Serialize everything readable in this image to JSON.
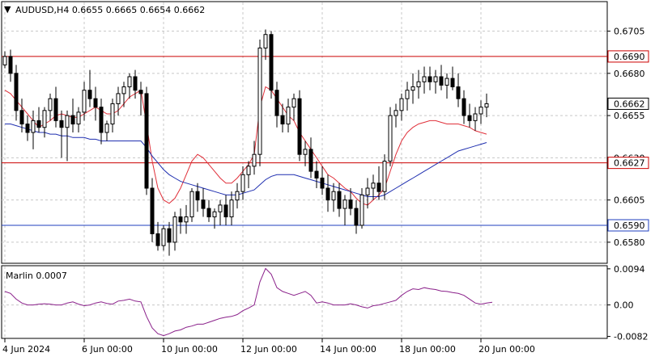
{
  "header": {
    "menu_glyph": "▼",
    "symbol_line": "AUDUSD,H4  0.6655 0.6665 0.6654 0.6662"
  },
  "chart_data": [
    {
      "type": "candlestick",
      "symbol": "AUDUSD",
      "timeframe": "H4",
      "ohlc_last": {
        "open": 0.6655,
        "high": 0.6665,
        "low": 0.6654,
        "close": 0.6662
      },
      "ylim": [
        0.6568,
        0.6722
      ],
      "y_ticks": [
        0.6705,
        0.668,
        0.6655,
        0.663,
        0.6605,
        0.658
      ],
      "y_tick_labels": [
        "0.6705",
        "0.6680",
        "0.6655",
        "0.6630",
        "0.6605",
        "0.6580"
      ],
      "x_tick_labels": [
        "4 Jun 2024",
        "6 Jun 00:00",
        "10 Jun 00:00",
        "12 Jun 00:00",
        "14 Jun 00:00",
        "18 Jun 00:00",
        "20 Jun 00:00"
      ],
      "x_tick_bar_index": [
        0,
        14,
        28,
        42,
        56,
        70,
        84
      ],
      "bar_count": 92,
      "grid": true,
      "horizontal_levels": [
        {
          "value": 0.669,
          "label": "0.6690",
          "color": "#cc0000"
        },
        {
          "value": 0.6627,
          "label": "0.6627",
          "color": "#cc0000"
        },
        {
          "value": 0.659,
          "label": "0.6590",
          "color": "#1f3fbf"
        }
      ],
      "current_price": {
        "value": 0.6662,
        "label": "0.6662"
      },
      "candles": [
        [
          0.6685,
          0.6693,
          0.6683,
          0.669
        ],
        [
          0.669,
          0.6694,
          0.6675,
          0.668
        ],
        [
          0.668,
          0.6685,
          0.6652,
          0.6658
        ],
        [
          0.6658,
          0.6665,
          0.6645,
          0.665
        ],
        [
          0.665,
          0.6655,
          0.664,
          0.6645
        ],
        [
          0.6645,
          0.6658,
          0.6635,
          0.6652
        ],
        [
          0.6652,
          0.666,
          0.6645,
          0.6648
        ],
        [
          0.6648,
          0.666,
          0.6642,
          0.6658
        ],
        [
          0.6658,
          0.6668,
          0.6652,
          0.6665
        ],
        [
          0.6665,
          0.6672,
          0.6648,
          0.6652
        ],
        [
          0.6652,
          0.6658,
          0.663,
          0.6648
        ],
        [
          0.6648,
          0.6658,
          0.6628,
          0.6655
        ],
        [
          0.6655,
          0.6665,
          0.6645,
          0.665
        ],
        [
          0.665,
          0.666,
          0.6645,
          0.6657
        ],
        [
          0.6657,
          0.6675,
          0.6652,
          0.667
        ],
        [
          0.667,
          0.6682,
          0.666,
          0.6665
        ],
        [
          0.6665,
          0.6672,
          0.6652,
          0.666
        ],
        [
          0.666,
          0.6665,
          0.6638,
          0.6645
        ],
        [
          0.6645,
          0.6652,
          0.664,
          0.665
        ],
        [
          0.665,
          0.6665,
          0.6645,
          0.6662
        ],
        [
          0.6662,
          0.6672,
          0.6655,
          0.6668
        ],
        [
          0.6668,
          0.6675,
          0.666,
          0.6672
        ],
        [
          0.6672,
          0.668,
          0.6665,
          0.6678
        ],
        [
          0.6678,
          0.6682,
          0.6665,
          0.667
        ],
        [
          0.667,
          0.6675,
          0.6655,
          0.6668
        ],
        [
          0.6668,
          0.6672,
          0.6608,
          0.6612
        ],
        [
          0.6612,
          0.6618,
          0.658,
          0.6585
        ],
        [
          0.6585,
          0.6592,
          0.6575,
          0.6578
        ],
        [
          0.6578,
          0.659,
          0.6575,
          0.6588
        ],
        [
          0.6588,
          0.6592,
          0.6572,
          0.658
        ],
        [
          0.658,
          0.6598,
          0.6575,
          0.6595
        ],
        [
          0.6595,
          0.66,
          0.6585,
          0.6592
        ],
        [
          0.6592,
          0.6602,
          0.6585,
          0.6595
        ],
        [
          0.6595,
          0.6612,
          0.6592,
          0.661
        ],
        [
          0.661,
          0.6615,
          0.6598,
          0.6605
        ],
        [
          0.6605,
          0.6612,
          0.6595,
          0.66
        ],
        [
          0.66,
          0.6605,
          0.6592,
          0.6595
        ],
        [
          0.6595,
          0.66,
          0.6588,
          0.6598
        ],
        [
          0.6598,
          0.6605,
          0.659,
          0.6602
        ],
        [
          0.6602,
          0.6608,
          0.659,
          0.6595
        ],
        [
          0.6595,
          0.661,
          0.659,
          0.6605
        ],
        [
          0.6605,
          0.6615,
          0.66,
          0.661
        ],
        [
          0.661,
          0.6625,
          0.6605,
          0.662
        ],
        [
          0.662,
          0.6628,
          0.6612,
          0.6625
        ],
        [
          0.6625,
          0.664,
          0.662,
          0.6632
        ],
        [
          0.6632,
          0.67,
          0.6625,
          0.6695
        ],
        [
          0.6695,
          0.6706,
          0.6688,
          0.6703
        ],
        [
          0.6703,
          0.6705,
          0.6665,
          0.667
        ],
        [
          0.667,
          0.6675,
          0.6648,
          0.6655
        ],
        [
          0.6655,
          0.6662,
          0.6645,
          0.665
        ],
        [
          0.665,
          0.6665,
          0.6645,
          0.666
        ],
        [
          0.666,
          0.6668,
          0.6652,
          0.6665
        ],
        [
          0.6665,
          0.667,
          0.6628,
          0.6632
        ],
        [
          0.6632,
          0.664,
          0.6625,
          0.6635
        ],
        [
          0.6635,
          0.6642,
          0.6618,
          0.6622
        ],
        [
          0.6622,
          0.6628,
          0.6612,
          0.6618
        ],
        [
          0.6618,
          0.6625,
          0.6608,
          0.6612
        ],
        [
          0.6612,
          0.662,
          0.6598,
          0.6605
        ],
        [
          0.6605,
          0.6615,
          0.6598,
          0.661
        ],
        [
          0.661,
          0.6615,
          0.6595,
          0.66
        ],
        [
          0.66,
          0.6608,
          0.659,
          0.6605
        ],
        [
          0.6605,
          0.6612,
          0.6596,
          0.66
        ],
        [
          0.66,
          0.6605,
          0.6585,
          0.659
        ],
        [
          0.659,
          0.6612,
          0.6588,
          0.6608
        ],
        [
          0.6608,
          0.6618,
          0.66,
          0.6612
        ],
        [
          0.6612,
          0.662,
          0.6605,
          0.6615
        ],
        [
          0.6615,
          0.6625,
          0.6605,
          0.661
        ],
        [
          0.661,
          0.6632,
          0.6605,
          0.6628
        ],
        [
          0.6628,
          0.666,
          0.6625,
          0.6655
        ],
        [
          0.6655,
          0.6662,
          0.6648,
          0.6658
        ],
        [
          0.6658,
          0.6668,
          0.6652,
          0.6665
        ],
        [
          0.6665,
          0.6675,
          0.6658,
          0.667
        ],
        [
          0.667,
          0.668,
          0.6662,
          0.6672
        ],
        [
          0.6672,
          0.6682,
          0.6665,
          0.6675
        ],
        [
          0.6675,
          0.6684,
          0.6668,
          0.6678
        ],
        [
          0.6678,
          0.6684,
          0.667,
          0.6675
        ],
        [
          0.6675,
          0.6682,
          0.6668,
          0.6678
        ],
        [
          0.6678,
          0.6685,
          0.667,
          0.6673
        ],
        [
          0.6673,
          0.668,
          0.6665,
          0.6677
        ],
        [
          0.6677,
          0.6684,
          0.667,
          0.6672
        ],
        [
          0.6672,
          0.668,
          0.666,
          0.6665
        ],
        [
          0.6665,
          0.667,
          0.665,
          0.6655
        ],
        [
          0.6655,
          0.6662,
          0.6648,
          0.6652
        ],
        [
          0.6652,
          0.666,
          0.6646,
          0.6656
        ],
        [
          0.6656,
          0.6664,
          0.665,
          0.666
        ],
        [
          0.666,
          0.6668,
          0.6654,
          0.6662
        ]
      ],
      "indicators": [
        {
          "color": "#e0303a",
          "values": [
            0.667,
            0.6668,
            0.6664,
            0.666,
            0.6656,
            0.6652,
            0.6648,
            0.665,
            0.6652,
            0.6655,
            0.6656,
            0.6655,
            0.6654,
            0.6654,
            0.6656,
            0.6658,
            0.666,
            0.6658,
            0.6656,
            0.6656,
            0.6658,
            0.6662,
            0.6666,
            0.6668,
            0.667,
            0.665,
            0.6628,
            0.6612,
            0.6605,
            0.6603,
            0.6606,
            0.6612,
            0.662,
            0.6628,
            0.6632,
            0.663,
            0.6626,
            0.6622,
            0.6618,
            0.6615,
            0.6615,
            0.6618,
            0.6622,
            0.6626,
            0.6632,
            0.666,
            0.6672,
            0.667,
            0.6665,
            0.666,
            0.6655,
            0.6652,
            0.6645,
            0.664,
            0.6635,
            0.663,
            0.6625,
            0.662,
            0.6618,
            0.6615,
            0.6612,
            0.661,
            0.6606,
            0.6603,
            0.6602,
            0.6605,
            0.6608,
            0.6612,
            0.6622,
            0.6632,
            0.664,
            0.6645,
            0.6648,
            0.665,
            0.6651,
            0.6652,
            0.6652,
            0.6651,
            0.665,
            0.665,
            0.665,
            0.6649,
            0.6648,
            0.6646,
            0.6645,
            0.6644
          ]
        },
        {
          "color": "#1f2fb0",
          "values": [
            0.665,
            0.665,
            0.6649,
            0.6648,
            0.6647,
            0.6646,
            0.6645,
            0.6645,
            0.6644,
            0.6644,
            0.6643,
            0.6643,
            0.6642,
            0.6642,
            0.6642,
            0.6641,
            0.6641,
            0.664,
            0.664,
            0.664,
            0.664,
            0.664,
            0.664,
            0.664,
            0.664,
            0.6636,
            0.6631,
            0.6627,
            0.6623,
            0.662,
            0.6618,
            0.6616,
            0.6615,
            0.6614,
            0.6613,
            0.6612,
            0.6611,
            0.661,
            0.6609,
            0.6608,
            0.6608,
            0.6608,
            0.6609,
            0.661,
            0.6611,
            0.6614,
            0.6617,
            0.6619,
            0.662,
            0.662,
            0.662,
            0.662,
            0.6619,
            0.6618,
            0.6617,
            0.6616,
            0.6615,
            0.6614,
            0.6613,
            0.6612,
            0.6611,
            0.661,
            0.6609,
            0.6608,
            0.6607,
            0.6607,
            0.6607,
            0.6608,
            0.661,
            0.6612,
            0.6614,
            0.6616,
            0.6618,
            0.662,
            0.6622,
            0.6624,
            0.6626,
            0.6628,
            0.663,
            0.6632,
            0.6634,
            0.6635,
            0.6636,
            0.6637,
            0.6638,
            0.6639
          ]
        }
      ]
    },
    {
      "type": "line",
      "indicator_label": "Marlin 0.0007",
      "ylim": [
        -0.0085,
        0.01
      ],
      "y_ticks": [
        0.0094,
        0.0,
        -0.0082
      ],
      "y_tick_labels": [
        "0.0094",
        "0.00",
        "-0.0082"
      ],
      "zero_line": true,
      "color": "#8a208a",
      "values": [
        0.0035,
        0.003,
        0.0015,
        0.0005,
        0.0,
        0.0,
        0.0002,
        0.0003,
        0.0002,
        0.0,
        0.0,
        0.0005,
        0.0008,
        0.0002,
        -0.0002,
        0.0,
        0.0005,
        0.0008,
        0.0004,
        0.0002,
        0.001,
        0.0012,
        0.0015,
        0.001,
        0.0008,
        -0.003,
        -0.006,
        -0.0075,
        -0.008,
        -0.0075,
        -0.0068,
        -0.0065,
        -0.0058,
        -0.0055,
        -0.005,
        -0.005,
        -0.0045,
        -0.004,
        -0.0035,
        -0.0032,
        -0.003,
        -0.0025,
        -0.0015,
        -0.0008,
        0.0,
        0.006,
        0.0095,
        0.008,
        0.0045,
        0.0035,
        0.003,
        0.0025,
        0.003,
        0.0035,
        0.0025,
        0.0005,
        0.0008,
        0.0005,
        0.0,
        0.0,
        0.0,
        0.0003,
        0.0,
        -0.0005,
        -0.0008,
        -0.0002,
        0.0,
        0.0004,
        0.0008,
        0.0012,
        0.0025,
        0.0035,
        0.0042,
        0.004,
        0.0045,
        0.0042,
        0.004,
        0.0036,
        0.0035,
        0.0032,
        0.003,
        0.0025,
        0.0015,
        0.0005,
        0.0002,
        0.0005,
        0.0007
      ]
    }
  ]
}
